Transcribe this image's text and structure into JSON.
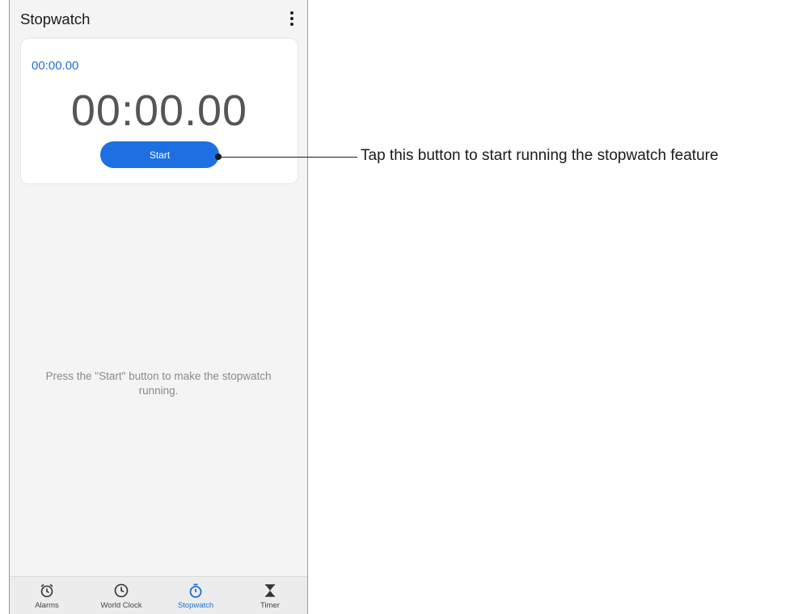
{
  "app": {
    "title": "Stopwatch",
    "menu_icon": "more-vert-icon"
  },
  "stopwatch": {
    "lap_time": "00:00.00",
    "main_time": "00:00.00",
    "start_label": "Start"
  },
  "hint": "Press the \"Start\" button to make the stopwatch running.",
  "nav": {
    "items": [
      {
        "label": "Alarms",
        "icon": "alarm-icon",
        "active": false
      },
      {
        "label": "World Clock",
        "icon": "clock-icon",
        "active": false
      },
      {
        "label": "Stopwatch",
        "icon": "stopwatch-icon",
        "active": true
      },
      {
        "label": "Timer",
        "icon": "hourglass-icon",
        "active": false
      }
    ]
  },
  "callout": {
    "text": "Tap this button to start running the stopwatch feature"
  },
  "colors": {
    "accent": "#1d6fe2",
    "text_blue": "#1f6fd1"
  }
}
